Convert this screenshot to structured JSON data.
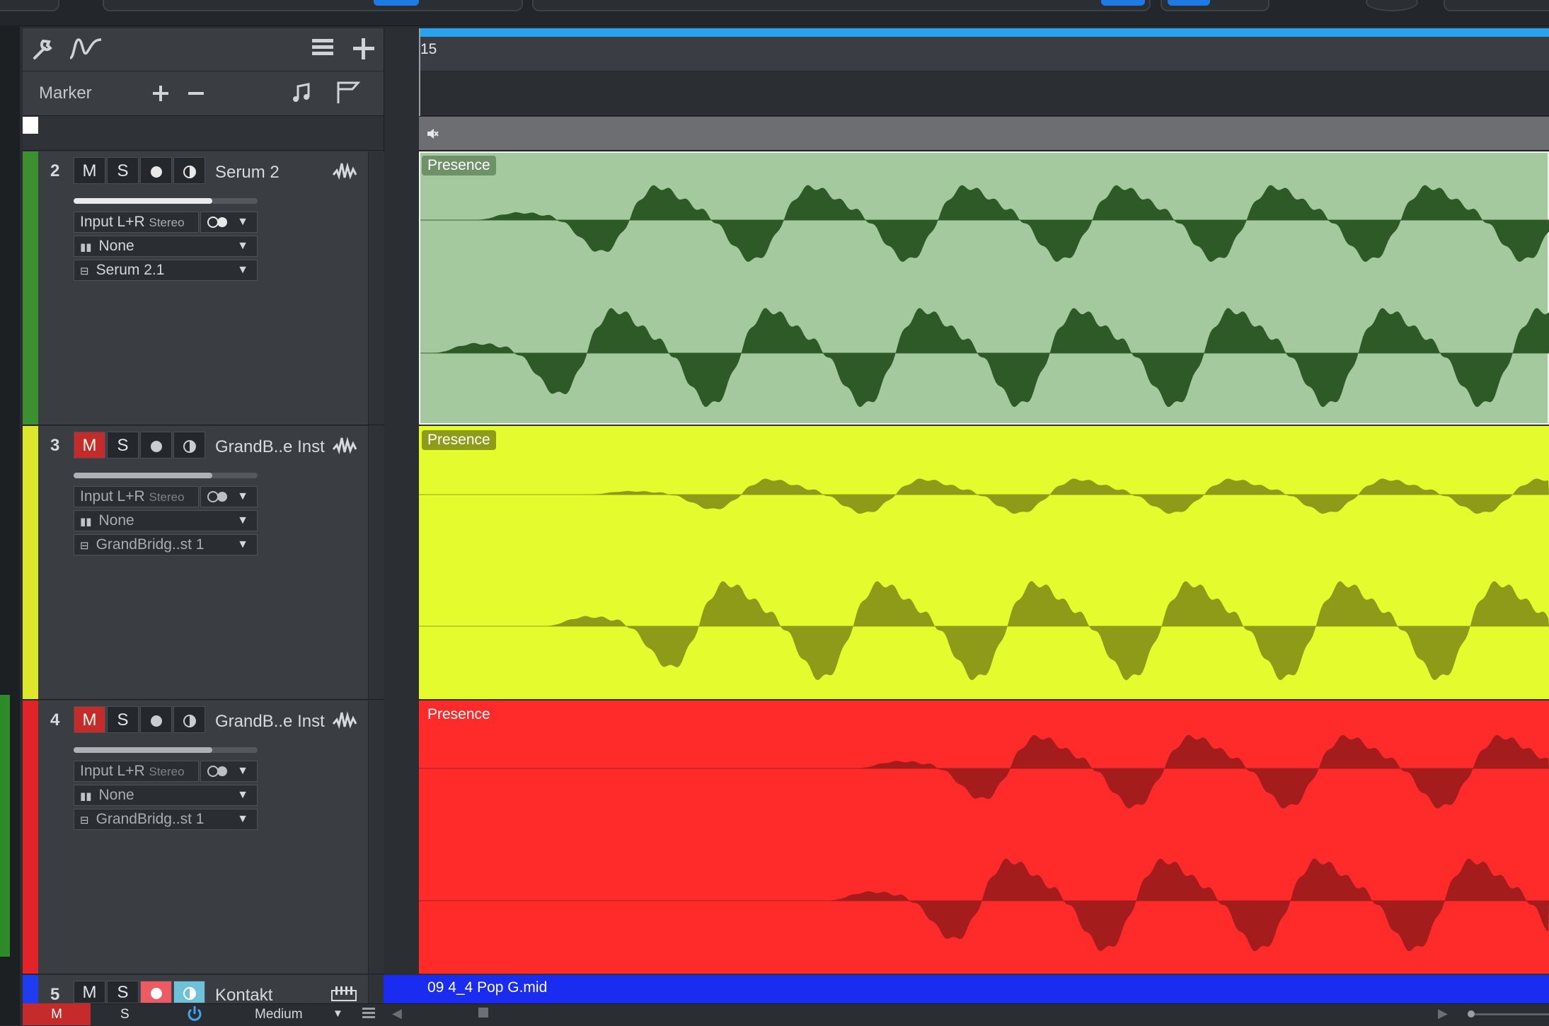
{
  "toolbar": {
    "marker_label": "Marker"
  },
  "ruler": {
    "bar_label": "15"
  },
  "tracks": [
    {
      "number": "2",
      "name": "Serum 2",
      "mute": "M",
      "solo": "S",
      "input": "Input L+R",
      "input_mode": "Stereo",
      "output": "None",
      "instrument": "Serum 2.1",
      "color": "#3d8f2f",
      "clip_label": "Presence",
      "clip_bg": "#a4c99f",
      "wave_color": "#2e5a27"
    },
    {
      "number": "3",
      "name": "GrandB..e Inst",
      "mute": "M",
      "solo": "S",
      "input": "Input L+R",
      "input_mode": "Stereo",
      "output": "None",
      "instrument": "GrandBridg..st 1",
      "color": "#dde82a",
      "clip_label": "Presence",
      "clip_bg": "#e4fb2e",
      "wave_color": "#8e9b18"
    },
    {
      "number": "4",
      "name": "GrandB..e Inst",
      "mute": "M",
      "solo": "S",
      "input": "Input L+R",
      "input_mode": "Stereo",
      "output": "None",
      "instrument": "GrandBridg..st 1",
      "color": "#e2232a",
      "clip_label": "Presence",
      "clip_bg": "#ff2a2a",
      "wave_color": "#a51c1c"
    },
    {
      "number": "5",
      "name": "Kontakt",
      "mute": "M",
      "solo": "S",
      "color": "#1f3df0",
      "clip_label": "09 4_4 Pop G.mid",
      "clip_bg": "#1a2cf0"
    }
  ],
  "bottom": {
    "mute": "M",
    "solo": "S",
    "zoom": "Medium"
  }
}
